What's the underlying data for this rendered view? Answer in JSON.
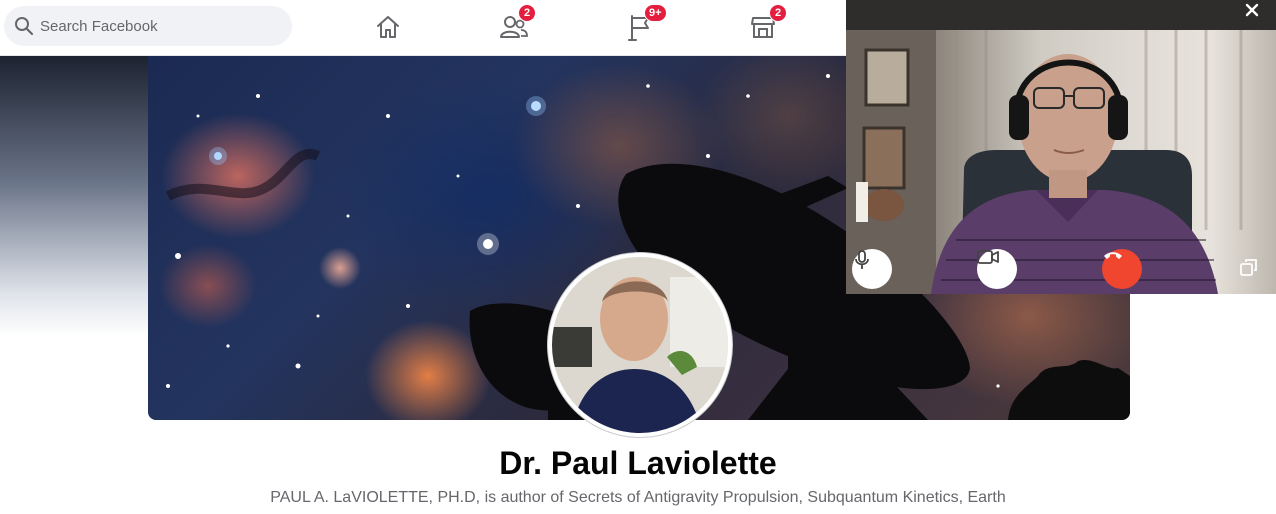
{
  "search": {
    "placeholder": "Search Facebook"
  },
  "nav": {
    "home": {
      "icon": "home-icon"
    },
    "friends": {
      "icon": "friends-icon",
      "badge": "2"
    },
    "pages": {
      "icon": "flag-icon",
      "badge": "9+"
    },
    "marketplace": {
      "icon": "marketplace-icon",
      "badge": "2"
    }
  },
  "profile": {
    "name": "Dr. Paul Laviolette",
    "bio": "PAUL A. LaVIOLETTE, PH.D, is author of Secrets of Antigravity Propulsion, Subquantum Kinetics, Earth"
  },
  "video_call": {
    "controls": [
      "microphone-icon",
      "camera-icon",
      "end-call-icon",
      "minimize-icon",
      "close-icon"
    ],
    "colors": {
      "end_call": "#f0452f",
      "control_bg": "#ffffff"
    }
  },
  "colors": {
    "badge": "#e41e3f",
    "text_primary": "#050505",
    "text_secondary": "#65676b",
    "search_bg": "#f0f2f5"
  }
}
